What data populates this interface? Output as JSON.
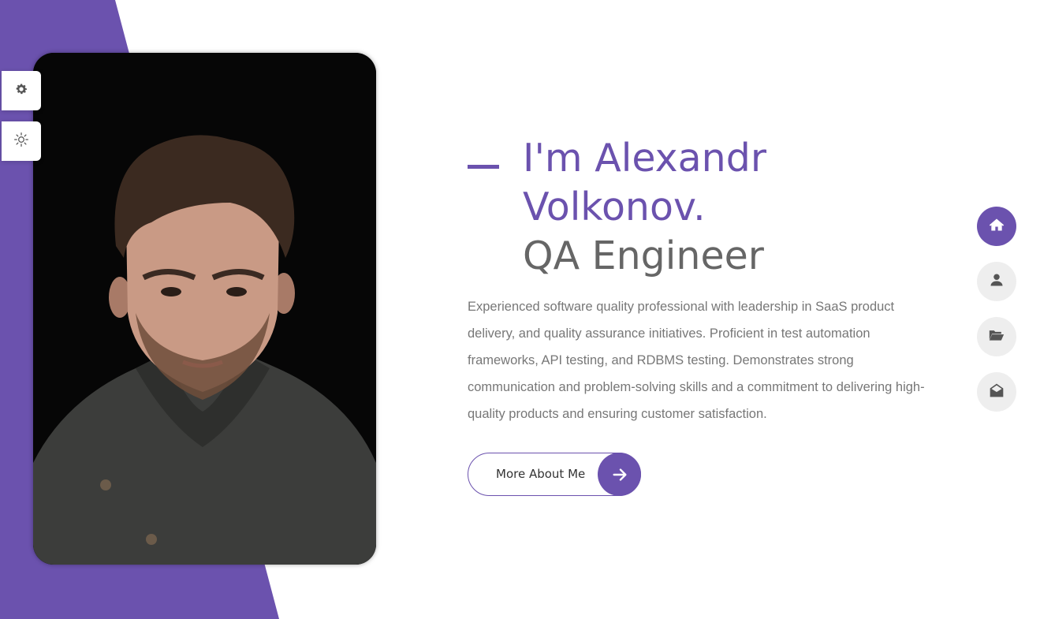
{
  "heading": {
    "name": "I'm Alexandr\nVolkonov.",
    "role": "QA Engineer"
  },
  "bio": "Experienced software quality professional with leadership in SaaS product delivery, and quality assurance initiatives. Proficient in test automation frameworks, API testing, and RDBMS testing. Demonstrates strong communication and problem-solving skills and a commitment to delivering high-quality products and ensuring customer satisfaction.",
  "cta": {
    "label": "More About Me",
    "icon": "arrow-right-icon"
  },
  "side_controls": [
    {
      "icon": "gear-icon",
      "purpose": "settings"
    },
    {
      "icon": "sun-icon",
      "purpose": "theme-toggle"
    }
  ],
  "nav": [
    {
      "icon": "home-icon",
      "active": true
    },
    {
      "icon": "user-icon",
      "active": false
    },
    {
      "icon": "folder-open-icon",
      "active": false
    },
    {
      "icon": "envelope-open-icon",
      "active": false
    }
  ],
  "colors": {
    "accent": "#6b52ae",
    "text_muted": "#777777",
    "heading_gray": "#666666"
  }
}
